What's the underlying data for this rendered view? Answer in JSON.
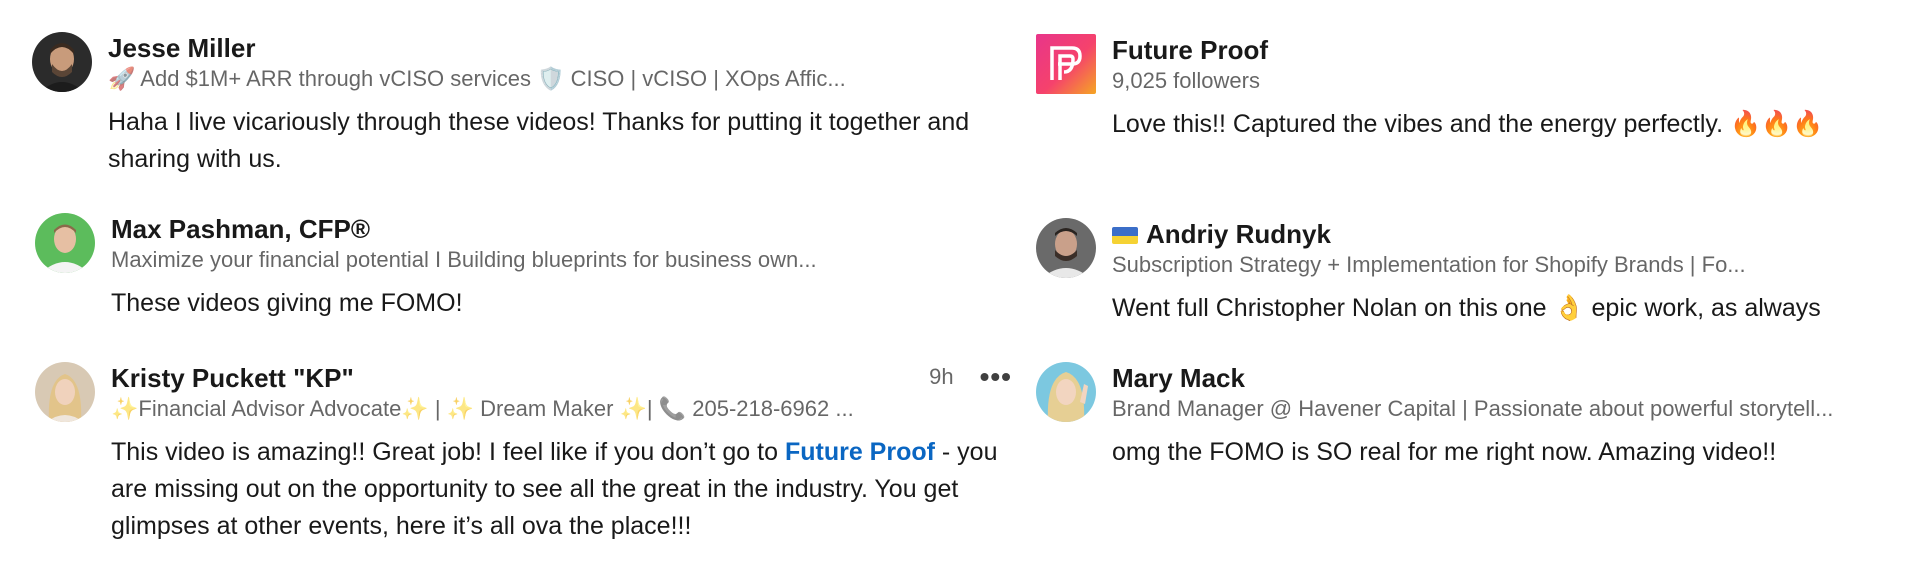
{
  "comments_left": [
    {
      "name": "Jesse Miller",
      "headline": "🚀 Add $1M+ ARR through vCISO services 🛡️ CISO | vCISO | XOps Affic...",
      "text": "Haha I live vicariously through these videos! Thanks for putting it together and sharing with us."
    },
    {
      "name": "Max Pashman, CFP®",
      "headline": "Maximize your financial potential I Building blueprints for business own...",
      "text": "These videos giving me FOMO!"
    },
    {
      "name": "Kristy Puckett \"KP\"",
      "headline": "✨Financial Advisor Advocate✨ | ✨ Dream Maker ✨| 📞 205-218-6962 ...",
      "time": "9h",
      "more": "•••",
      "text_before": "This video is amazing!! Great job! I feel like if you don’t go to ",
      "mention": "Future Proof",
      "text_after": " - you are missing out on the opportunity to see all the great in the industry. You get glimpses at other events, here it’s all ova the place!!!"
    }
  ],
  "comments_right": [
    {
      "name": "Future Proof",
      "headline": "9,025 followers",
      "text": "Love this!! Captured the vibes and the energy perfectly. 🔥🔥🔥"
    },
    {
      "name": "Andriy Rudnyk",
      "headline": "Subscription Strategy + Implementation for Shopify Brands | Fo...",
      "text": "Went full Christopher Nolan on this one 👌 epic work, as always"
    },
    {
      "name": "Mary Mack",
      "headline": "Brand Manager @ Havener Capital | Passionate about powerful storytell...",
      "text": "omg the FOMO is SO real for me right now. Amazing video!!"
    }
  ],
  "colors": {
    "link": "#0a66c2",
    "future_proof_gradient": [
      "#f5426c",
      "#f5a623"
    ]
  }
}
